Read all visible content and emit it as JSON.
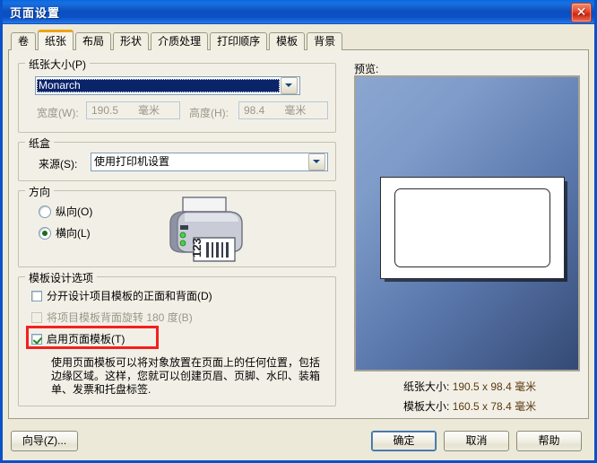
{
  "window": {
    "title": "页面设置",
    "close_icon": "close-icon"
  },
  "tabs": [
    {
      "label": "卷",
      "selected": false
    },
    {
      "label": "纸张",
      "selected": true
    },
    {
      "label": "布局",
      "selected": false
    },
    {
      "label": "形状",
      "selected": false
    },
    {
      "label": "介质处理",
      "selected": false
    },
    {
      "label": "打印顺序",
      "selected": false
    },
    {
      "label": "模板",
      "selected": false
    },
    {
      "label": "背景",
      "selected": false
    }
  ],
  "paper_size": {
    "legend": "纸张大小(P)",
    "combo_value": "Monarch",
    "width_label": "宽度(W):",
    "width_value": "190.5",
    "width_unit": "毫米",
    "height_label": "高度(H):",
    "height_value": "98.4",
    "height_unit": "毫米"
  },
  "tray": {
    "legend": "纸盒",
    "source_label": "来源(S):",
    "source_value": "使用打印机设置"
  },
  "orientation": {
    "legend": "方向",
    "portrait_label": "纵向(O)",
    "landscape_label": "横向(L)",
    "selected": "landscape",
    "printer_icon": "printer-icon"
  },
  "template_options": {
    "legend": "模板设计选项",
    "items": [
      {
        "label": "分开设计项目模板的正面和背面(D)",
        "checked": false,
        "disabled": false,
        "annotated": false
      },
      {
        "label": "将项目模板背面旋转 180 度(B)",
        "checked": false,
        "disabled": true,
        "annotated": false
      },
      {
        "label": "启用页面模板(T)",
        "checked": true,
        "disabled": false,
        "annotated": true
      }
    ],
    "description": "使用页面模板可以将对象放置在页面上的任何位置，包括边缘区域。这样，您就可以创建页眉、页脚、水印、装箱单、发票和托盘标签."
  },
  "preview": {
    "label": "预览:",
    "paper_size_label": "纸张大小:",
    "paper_size_value": "190.5 x 98.4 毫米",
    "template_size_label": "模板大小:",
    "template_size_value": "160.5 x 78.4 毫米"
  },
  "buttons": {
    "wizard": "向导(Z)...",
    "ok": "确定",
    "cancel": "取消",
    "help": "帮助"
  },
  "colors": {
    "accent": "#f0a419",
    "titlebar": "#0a52c8",
    "annotation": "#f42020",
    "dialog_bg": "#ece9d8"
  }
}
